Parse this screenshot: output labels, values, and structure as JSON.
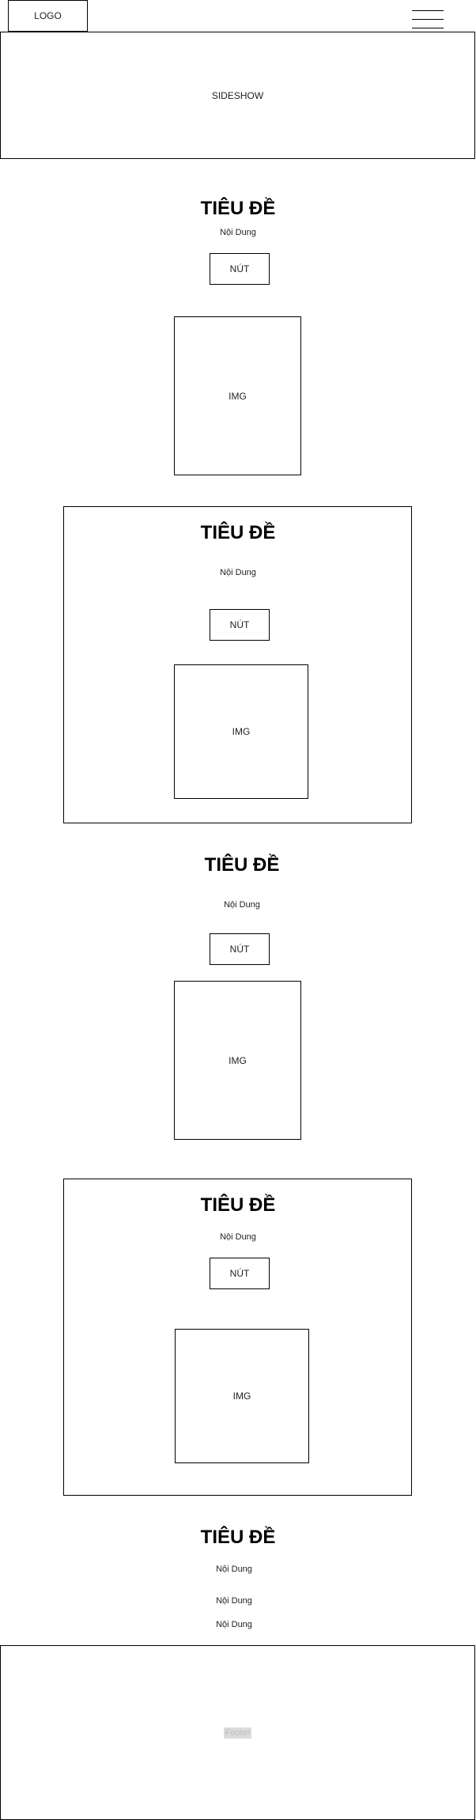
{
  "header": {
    "logo_label": "LOGO",
    "menu_icon": "hamburger-menu-icon"
  },
  "slideshow": {
    "label": "SIDESHOW"
  },
  "section1": {
    "title": "TIÊU ĐỀ",
    "content": "Nội Dung",
    "button": "NÚT",
    "image": "IMG"
  },
  "section2": {
    "title": "TIÊU ĐỀ",
    "content": "Nội Dung",
    "button": "NÚT",
    "image": "IMG"
  },
  "section3": {
    "title": "TIÊU ĐỀ",
    "content": "Nội Dung",
    "button": "NÚT",
    "image": "IMG"
  },
  "section4": {
    "title": "TIÊU ĐỀ",
    "content": "Nội Dung",
    "button": "NÚT",
    "image": "IMG"
  },
  "section5": {
    "title": "TIÊU ĐỀ",
    "lines": [
      "Nội Dung",
      "Nội Dung",
      "Nội Dung"
    ]
  },
  "footer": {
    "label": "Footer"
  }
}
